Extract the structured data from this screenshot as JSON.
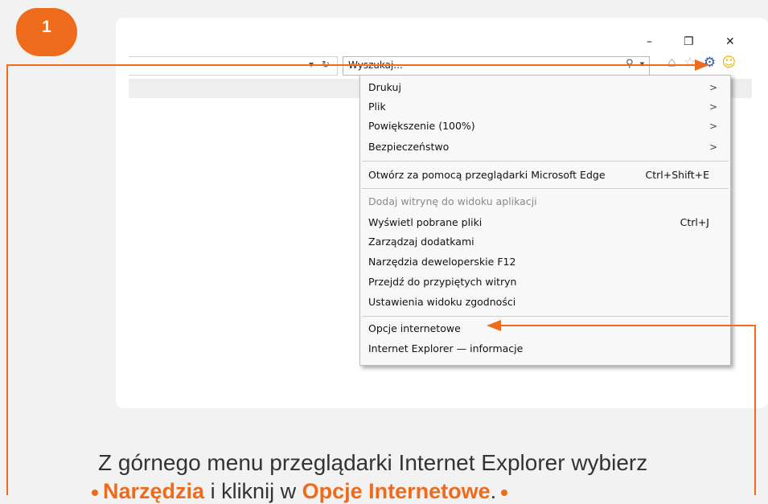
{
  "step": {
    "number": "1"
  },
  "window": {
    "minimize": "–",
    "restore": "❐",
    "close": "✕"
  },
  "address": {
    "dropdown": "▾",
    "refresh": "↻"
  },
  "search": {
    "value": "Wyszukaj...",
    "search_glyph": "⚲",
    "dropdown": "▾"
  },
  "toolbar": {
    "home_glyph": "⌂",
    "favorites_glyph": "☆",
    "tools_glyph": "⚙",
    "feedback_glyph": "☺"
  },
  "menu": {
    "items": [
      {
        "label": "Drukuj",
        "arrow": ">"
      },
      {
        "label": "Plik",
        "arrow": ">"
      },
      {
        "label": "Powiększenie (100%)",
        "arrow": ">"
      },
      {
        "label": "Bezpieczeństwo",
        "arrow": ">"
      },
      {
        "label": "Otwórz za pomocą przeglądarki Microsoft Edge",
        "shortcut": "Ctrl+Shift+E"
      },
      {
        "label": "Dodaj witrynę do widoku aplikacji",
        "disabled": true
      },
      {
        "label": "Wyświetl pobrane pliki",
        "shortcut": "Ctrl+J"
      },
      {
        "label": "Zarządzaj dodatkami"
      },
      {
        "label": "Narzędzia deweloperskie F12"
      },
      {
        "label": "Przejdź do przypiętych witryn"
      },
      {
        "label": "Ustawienia widoku zgodności"
      },
      {
        "label": "Opcje internetowe"
      },
      {
        "label": "Internet Explorer — informacje"
      }
    ]
  },
  "caption": {
    "line1": "Z górnego menu przeglądarki Internet Explorer wybierz",
    "line2_prefix": "Narzędzia",
    "line2_mid": " i kliknij w ",
    "line2_emph": "Opcje Internetowe",
    "line2_suffix": "."
  },
  "colors": {
    "accent": "#ee6b1c"
  }
}
